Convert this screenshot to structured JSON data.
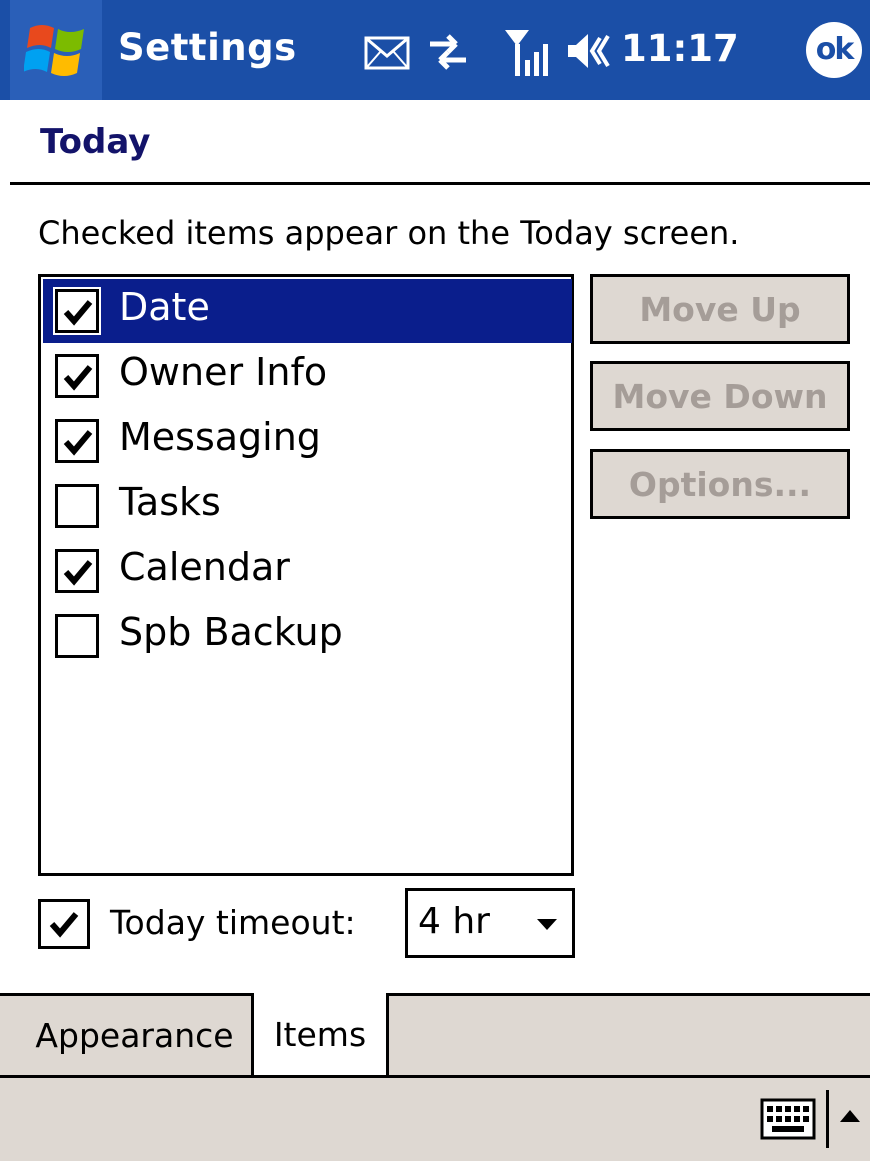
{
  "title_bar": {
    "app_title": "Settings",
    "clock": "11:17",
    "ok_label": "ok",
    "icons": [
      "windows-start-icon",
      "envelope-icon",
      "connectivity-arrows-icon",
      "signal-strength-icon",
      "speaker-volume-icon"
    ]
  },
  "page": {
    "title": "Today",
    "instructions": "Checked items appear on the Today screen."
  },
  "items": [
    {
      "label": "Date",
      "checked": true,
      "selected": true
    },
    {
      "label": "Owner Info",
      "checked": true,
      "selected": false
    },
    {
      "label": "Messaging",
      "checked": true,
      "selected": false
    },
    {
      "label": "Tasks",
      "checked": false,
      "selected": false
    },
    {
      "label": "Calendar",
      "checked": true,
      "selected": false
    },
    {
      "label": "Spb Backup",
      "checked": false,
      "selected": false
    }
  ],
  "buttons": {
    "move_up": "Move Up",
    "move_down": "Move Down",
    "options": "Options..."
  },
  "timeout": {
    "checked": true,
    "label": "Today timeout:",
    "value": "4 hr"
  },
  "tabs": {
    "appearance": "Appearance",
    "items": "Items",
    "active": "Items"
  },
  "menubar": {
    "icons": [
      "keyboard-icon",
      "input-panel-arrow-icon"
    ]
  },
  "colors": {
    "title_bar": "#1b4fa7",
    "selection": "#0a1e8c",
    "page_title": "#13136a",
    "disabled_button_bg": "#ded8d2",
    "disabled_button_text": "#a59d98"
  }
}
